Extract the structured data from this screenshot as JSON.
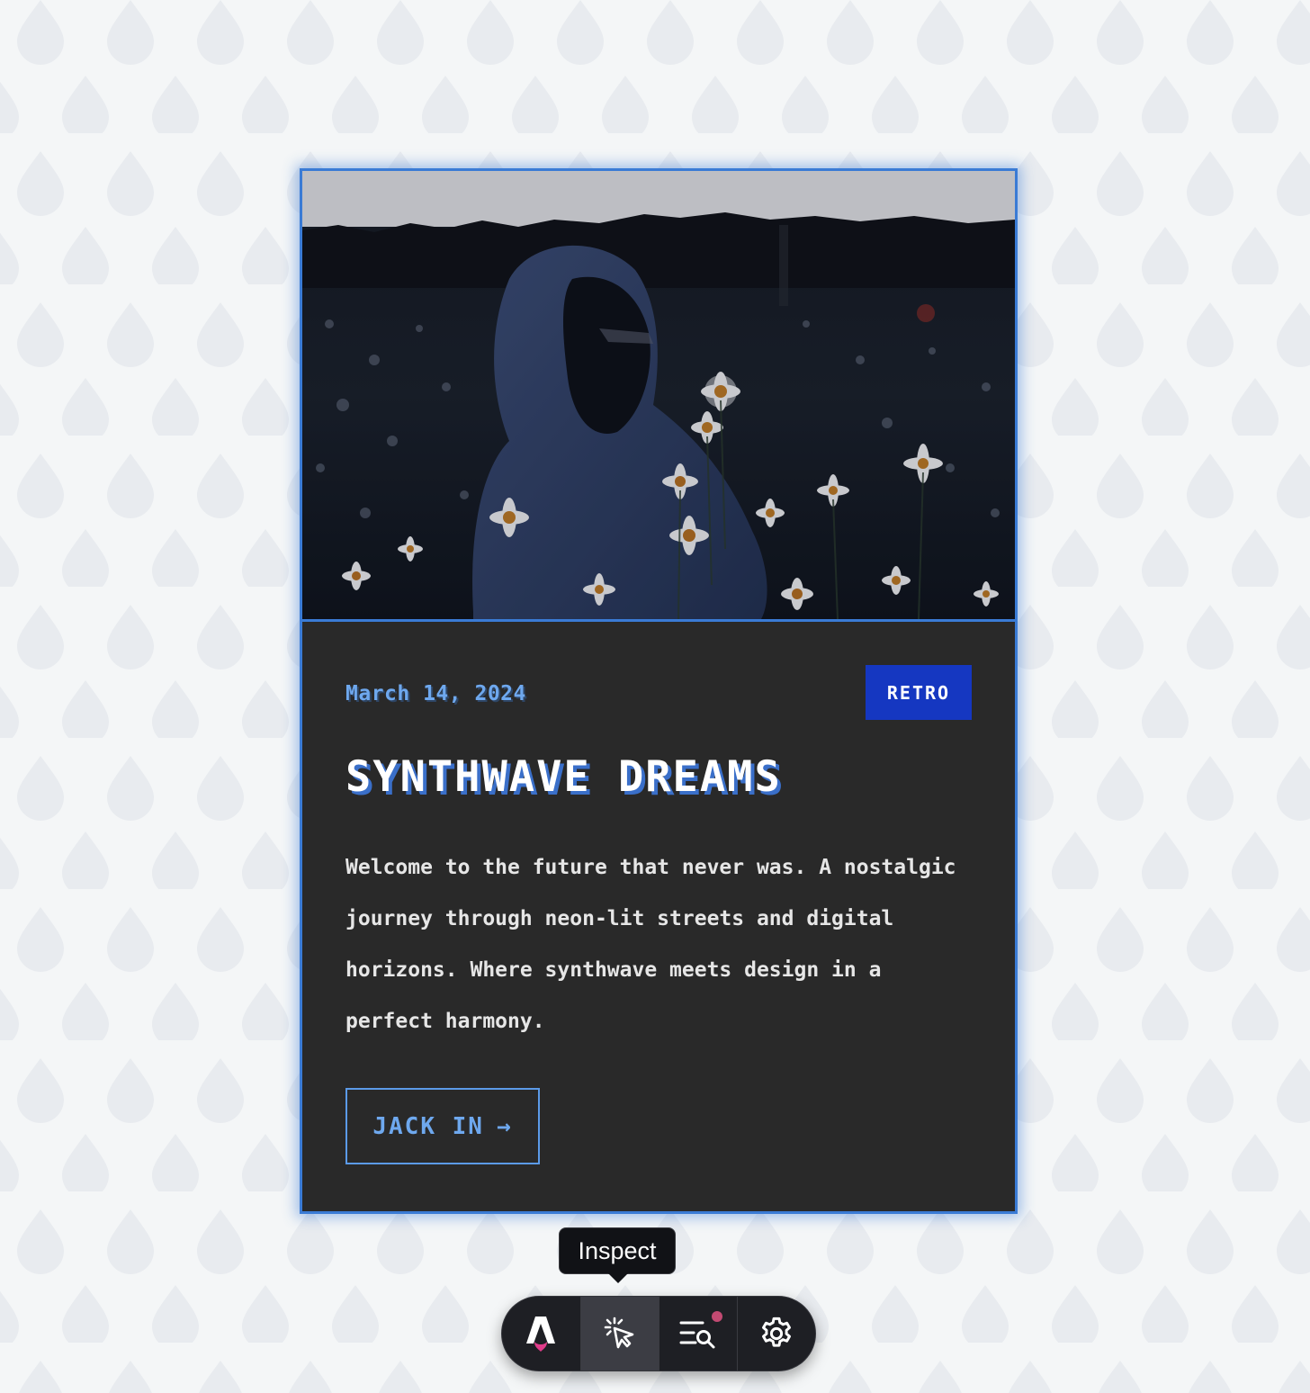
{
  "card": {
    "date": "March 14, 2024",
    "badge": "RETRO",
    "title": "SYNTHWAVE DREAMS",
    "description": "Welcome to the future that never was. A nostalgic journey through neon-lit streets and digital horizons. Where synthwave meets design in a perfect harmony.",
    "cta_label": "JACK IN",
    "cta_arrow": "→"
  },
  "tooltip": {
    "text": "Inspect"
  },
  "toolbar": {
    "items": [
      {
        "name": "astro-logo-icon"
      },
      {
        "name": "inspect-cursor-icon",
        "active": true
      },
      {
        "name": "audit-search-icon",
        "has_notification": true
      },
      {
        "name": "settings-gear-icon"
      }
    ]
  },
  "colors": {
    "accent": "#3a7bd5",
    "badge_bg": "#1537c1",
    "card_bg": "#292929",
    "page_bg": "#f4f6f7",
    "notification": "#c24a72"
  }
}
